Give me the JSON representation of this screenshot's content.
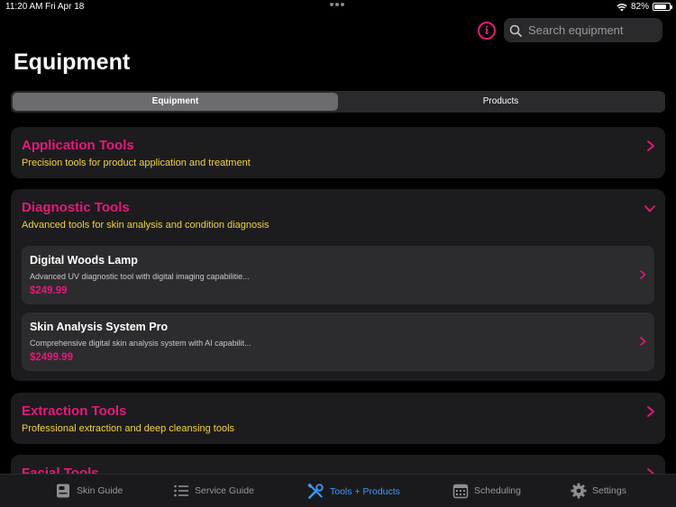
{
  "status": {
    "time": "11:20 AM",
    "date": "Fri Apr 18",
    "battery": "82%",
    "battery_level": 0.82
  },
  "header": {
    "title": "Equipment",
    "search_placeholder": "Search equipment"
  },
  "segments": [
    {
      "label": "Equipment",
      "active": true
    },
    {
      "label": "Products",
      "active": false
    }
  ],
  "categories": [
    {
      "title": "Application Tools",
      "description": "Precision tools for product application and treatment",
      "expanded": false
    },
    {
      "title": "Diagnostic Tools",
      "description": "Advanced tools for skin analysis and condition diagnosis",
      "expanded": true,
      "items": [
        {
          "name": "Digital Woods Lamp",
          "description": "Advanced UV diagnostic tool with digital imaging capabilitie...",
          "price": "$249.99"
        },
        {
          "name": "Skin Analysis System Pro",
          "description": "Comprehensive digital skin analysis system with AI capabilit...",
          "price": "$2499.99"
        }
      ]
    },
    {
      "title": "Extraction Tools",
      "description": "Professional extraction and deep cleansing tools",
      "expanded": false
    },
    {
      "title": "Facial Tools",
      "description": "",
      "expanded": false
    }
  ],
  "tabs": [
    {
      "label": "Skin Guide",
      "icon": "book-icon",
      "active": false
    },
    {
      "label": "Service Guide",
      "icon": "list-icon",
      "active": false
    },
    {
      "label": "Tools + Products",
      "icon": "tools-icon",
      "active": true
    },
    {
      "label": "Scheduling",
      "icon": "calendar-icon",
      "active": false
    },
    {
      "label": "Settings",
      "icon": "gear-icon",
      "active": false
    }
  ],
  "colors": {
    "accent": "#e5197c",
    "description": "#f2d33a",
    "tab_active": "#3e9bff",
    "background": "#000000",
    "card": "#1c1c1e"
  }
}
